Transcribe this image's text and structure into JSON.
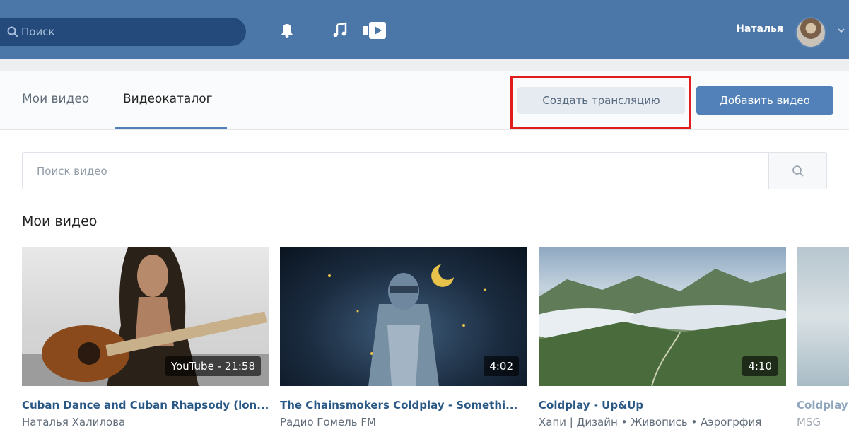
{
  "topbar": {
    "search_placeholder": "Поиск",
    "user_name": "Наталья",
    "icons": [
      "search-icon",
      "bell-icon",
      "music-icon",
      "video-play-icon",
      "chevron-down-icon"
    ],
    "background_color": "#4a76a8"
  },
  "tabs": {
    "items": [
      {
        "label": "Мои видео",
        "active": false
      },
      {
        "label": "Видеокаталог",
        "active": true
      }
    ],
    "create_stream_label": "Создать трансляцию",
    "add_video_label": "Добавить видео"
  },
  "video_search": {
    "placeholder": "Поиск видео"
  },
  "my_videos": {
    "title": "Мои видео",
    "items": [
      {
        "title": "Cuban Dance and Cuban Rhapsody (lon...",
        "author": "Наталья Халилова",
        "duration": "YouTube - 21:58"
      },
      {
        "title": "The Chainsmokers Coldplay - Somethi...",
        "author": "Радио Гомель FM",
        "duration": "4:02"
      },
      {
        "title": "Coldplay - Up&Up",
        "author": "Хапи | Дизайн • Живопись • Аэрогрфия",
        "duration": "4:10"
      },
      {
        "title": "Coldplay",
        "author": "MSG",
        "duration": ""
      }
    ]
  },
  "colors": {
    "accent": "#5181b8",
    "link": "#2a5885",
    "highlight": "#e01c1c"
  }
}
